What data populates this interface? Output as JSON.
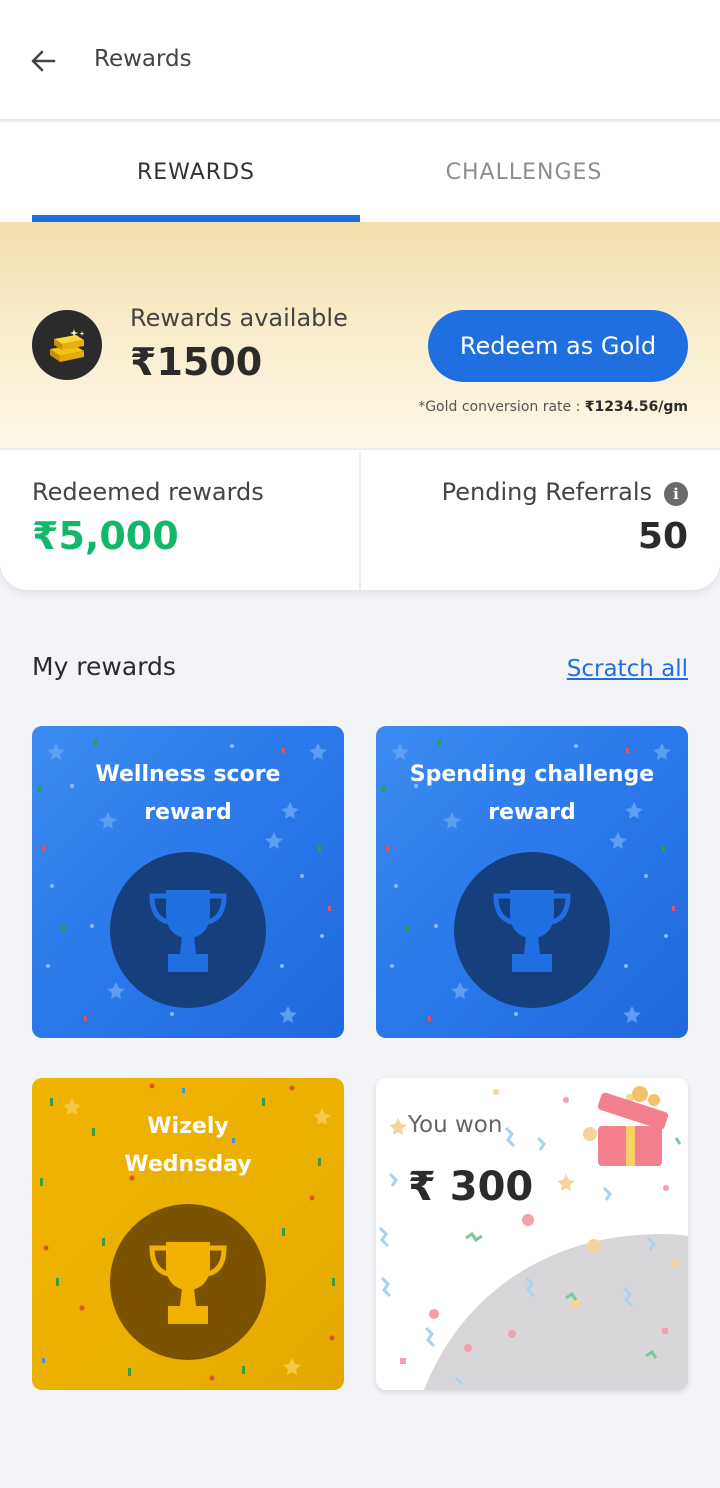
{
  "appbar": {
    "title": "Rewards",
    "back_icon": "arrow-left-icon"
  },
  "tabs": [
    {
      "label": "REWARDS",
      "active": true
    },
    {
      "label": "CHALLENGES",
      "active": false
    }
  ],
  "summary": {
    "rewards_label": "Rewards available",
    "rewards_amount": "₹1500",
    "redeem_button": "Redeem as Gold",
    "conversion_prefix": "*Gold conversion rate : ",
    "conversion_rate": "₹1234.56/gm",
    "redeemed_label": "Redeemed rewards",
    "redeemed_value": "₹5,000",
    "pending_label": "Pending Referrals",
    "pending_value": "50"
  },
  "my_rewards": {
    "title": "My rewards",
    "scratch_all": "Scratch all",
    "cards": [
      {
        "title_line1": "Wellness score",
        "title_line2": "reward",
        "icon": "trophy-icon"
      },
      {
        "title_line1": "Spending challenge",
        "title_line2": "reward",
        "icon": "trophy-icon"
      },
      {
        "title_line1": "Wizely",
        "title_line2": "Wednsday",
        "icon": "trophy-icon"
      },
      {
        "won_label": "You won",
        "won_amount": "₹ 300",
        "icon": "gift-icon"
      }
    ]
  },
  "colors": {
    "accent": "#1f6fe0",
    "green": "#12b76a",
    "card_blue": "#2a78ea",
    "card_yellow": "#eab000"
  }
}
